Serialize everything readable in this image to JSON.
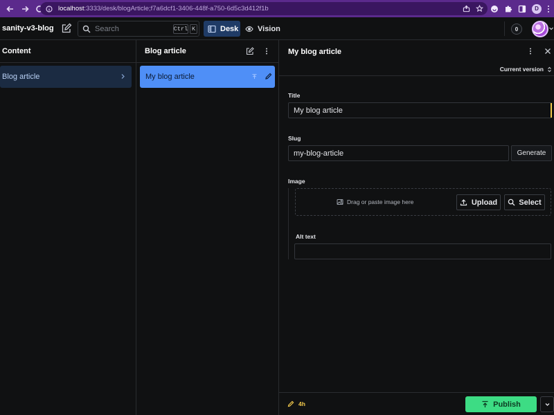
{
  "browser": {
    "url_host": "localhost",
    "url_path": ":3333/desk/blogArticle;f7a6dcf1-3406-448f-a750-6d5c3d412f1b",
    "profile_initial": "D"
  },
  "topbar": {
    "project_name": "sanity-v3-blog",
    "search_placeholder": "Search",
    "kbd_ctrl": "Ctrl",
    "kbd_k": "K",
    "tools": [
      {
        "label": "Desk",
        "active": true,
        "icon": "desk-icon"
      },
      {
        "label": "Vision",
        "active": false,
        "icon": "eye-icon"
      }
    ],
    "notification_count": "0"
  },
  "content_pane": {
    "title": "Content",
    "items": [
      {
        "label": "Blog article",
        "selected": true
      }
    ]
  },
  "list_pane": {
    "title": "Blog article",
    "items": [
      {
        "label": "My blog article",
        "selected": true
      }
    ]
  },
  "document_pane": {
    "title": "My blog article",
    "version_label": "Current version",
    "fields": {
      "title_label": "Title",
      "title_value": "My blog article",
      "slug_label": "Slug",
      "slug_value": "my-blog-article",
      "generate_label": "Generate",
      "image_label": "Image",
      "drop_hint": "Drag or paste image here",
      "upload_label": "Upload",
      "select_label": "Select",
      "alt_label": "Alt text",
      "alt_value": ""
    },
    "footer": {
      "edited": "4h",
      "publish_label": "Publish"
    }
  },
  "colors": {
    "browser_chrome": "#5b2a8c",
    "background": "#101112",
    "accent_selected": "#4f8ff7",
    "publish": "#3ddc84",
    "presence": "#f2c94c"
  }
}
